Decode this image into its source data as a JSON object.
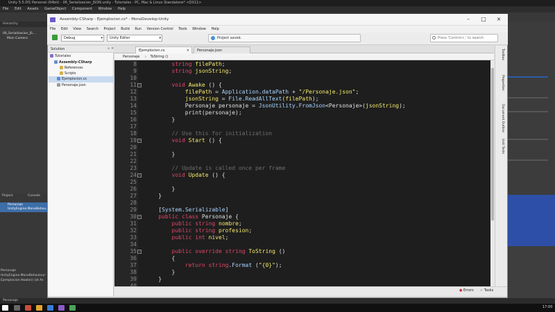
{
  "unity": {
    "title": "Unity 5.5.0f1 Personal (64bit) - 06_Serializacion_JSON.unity - Tutoriales - PC, Mac & Linux Standalone* <DX11>",
    "menu": [
      "File",
      "Edit",
      "Assets",
      "GameObject",
      "Component",
      "Window",
      "Help"
    ],
    "hierarchy_tab": "Hierarchy",
    "hierarchy_items": [
      "06_Serializacion_JS...",
      "Main Camera"
    ],
    "project_tab": "Project",
    "console_tab": "Console",
    "console_items": [
      "Personaje",
      "UnityEngine.MonoBehav..."
    ],
    "console_bottom": [
      "Personaje",
      "UnityEngine.MonoBehaviour:",
      "Ejemplocion:Awake() (at As"
    ],
    "status_text": "Personaje",
    "clock": "17:00"
  },
  "monodevelop": {
    "title": "Assembly-CSharp - Ejemplocion.cs* - MonoDevelop-Unity",
    "menu": [
      "File",
      "Edit",
      "View",
      "Search",
      "Project",
      "Build",
      "Run",
      "Version Control",
      "Tools",
      "Window",
      "Help"
    ],
    "config_combo": "Debug",
    "target_combo": "Unity Editor",
    "status_message": "Project saved.",
    "search_placeholder": "Press 'Control+,' to search",
    "solution_title": "Solution",
    "solution_items": [
      {
        "label": "Tutoriales",
        "depth": 0
      },
      {
        "label": "Assembly-CSharp",
        "depth": 1
      },
      {
        "label": "References",
        "depth": 2
      },
      {
        "label": "Scripts",
        "depth": 2
      },
      {
        "label": "Ejemplocion.cs",
        "depth": 3
      },
      {
        "label": "Personaje.json",
        "depth": 3
      }
    ],
    "tabs": [
      "Ejemplocion.cs",
      "Personaje.json"
    ],
    "breadcrumb": [
      "Personaje",
      "ToString ()"
    ],
    "side_pads": [
      "Toolbox",
      "Properties",
      "Document Outline",
      "Unit Tests"
    ],
    "bottom_items": [
      "Errors",
      "Tasks"
    ],
    "code": [
      {
        "n": "8",
        "t": "        string filePath;"
      },
      {
        "n": "9",
        "t": "        string jsonString;"
      },
      {
        "n": "10",
        "t": ""
      },
      {
        "n": "11",
        "t": "        void Awake () {"
      },
      {
        "n": "12",
        "t": "            filePath = Application.dataPath + \"/Personaje.json\";"
      },
      {
        "n": "13",
        "t": "            jsonString = File.ReadAllText(filePath);"
      },
      {
        "n": "14",
        "t": "            Personaje personaje = JsonUtility.FromJson<Personaje>(jsonString);"
      },
      {
        "n": "15",
        "t": "            print(personaje);"
      },
      {
        "n": "16",
        "t": "        }"
      },
      {
        "n": "17",
        "t": ""
      },
      {
        "n": "18",
        "t": "        // Use this for initialization"
      },
      {
        "n": "19",
        "t": "        void Start () {"
      },
      {
        "n": "20",
        "t": ""
      },
      {
        "n": "21",
        "t": "        }"
      },
      {
        "n": "22",
        "t": ""
      },
      {
        "n": "23",
        "t": "        // Update is called once per frame"
      },
      {
        "n": "24",
        "t": "        void Update () {"
      },
      {
        "n": "25",
        "t": ""
      },
      {
        "n": "26",
        "t": "        }"
      },
      {
        "n": "27",
        "t": "    }"
      },
      {
        "n": "28",
        "t": ""
      },
      {
        "n": "29",
        "t": "    [System.Serializable]"
      },
      {
        "n": "30",
        "t": "    public class Personaje {"
      },
      {
        "n": "31",
        "t": "        public string nombre;"
      },
      {
        "n": "32",
        "t": "        public string profesion;"
      },
      {
        "n": "33",
        "t": "        public int nivel;"
      },
      {
        "n": "34",
        "t": ""
      },
      {
        "n": "35",
        "t": "        public override string ToString ()"
      },
      {
        "n": "36",
        "t": "        {"
      },
      {
        "n": "37",
        "t": "            return string.Format (\"{0}\");"
      },
      {
        "n": "38",
        "t": "        }"
      },
      {
        "n": "39",
        "t": "    }"
      },
      {
        "n": "40",
        "t": ""
      }
    ]
  }
}
